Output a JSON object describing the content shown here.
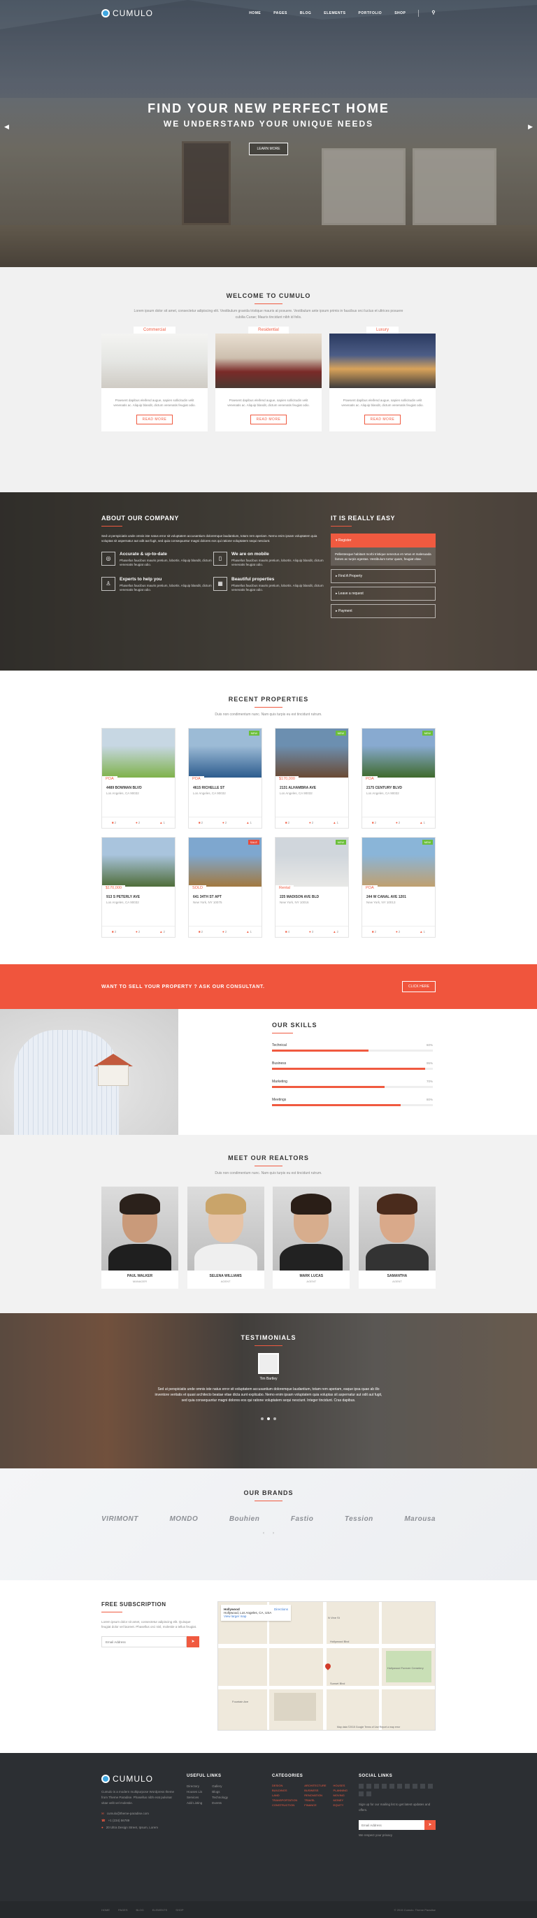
{
  "brand": {
    "name": "CUMULO",
    "accent": "#f05a40"
  },
  "nav": [
    "HOME",
    "PAGES",
    "BLOG",
    "ELEMENTS",
    "PORTFOLIO",
    "SHOP"
  ],
  "hero": {
    "title": "FIND YOUR NEW PERFECT HOME",
    "subtitle": "WE UNDERSTAND YOUR UNIQUE NEEDS",
    "button": "LEARN MORE"
  },
  "welcome": {
    "title": "WELCOME TO CUMULO",
    "text": "Lorem ipsum dolor sit amet, consectetur adipiscing elit. Vestibulum gravida tristique mauris at posuere. Vestibulum ante ipsum primis in faucibus orci luctus et ultrices posuere cubilia Curae; Mauris tincidunt nibh id felis.",
    "cards": [
      {
        "tag": "Commercial",
        "text": "Praesent dapibus eleifend augue, sapien sollicitudin velit venenatis ac. Aliquip blandit, dictum venenatis feugiat odio.",
        "button": "READ MORE"
      },
      {
        "tag": "Residential",
        "text": "Praesent dapibus eleifend augue, sapien sollicitudin velit venenatis ac. Aliquip blandit, dictum venenatis feugiat odio.",
        "button": "READ MORE"
      },
      {
        "tag": "Luxury",
        "text": "Praesent dapibus eleifend augue, sapien sollicitudin velit venenatis ac. Aliquip blandit, dictum venenatis feugiat odio.",
        "button": "READ MORE"
      }
    ]
  },
  "about": {
    "title": "ABOUT OUR COMPANY",
    "lead": "Sed ut perspiciatis unde omnis iste natus error sit voluptatem accusantium doloremque laudantium, totam rem aperiam. Nemo enim ipsam voluptatem quia voluptas sit aspernatur aut odit aut fugit, sed quia consequuntur magni dolores eos qui ratione voluptatem sequi nesciunt.",
    "features": [
      {
        "icon": "target-icon",
        "glyph": "◎",
        "title": "Accurate & up-to-date",
        "text": "Phasellus faucibus mauris pretium, lobortis. Aliquip blandit, dictum venenatis feugiat odio."
      },
      {
        "icon": "mobile-icon",
        "glyph": "▯",
        "title": "We are on mobile",
        "text": "Phasellus faucibus mauris pretium, lobortis. Aliquip blandit, dictum venenatis feugiat odio."
      },
      {
        "icon": "user-icon",
        "glyph": "♙",
        "title": "Experts to help you",
        "text": "Phasellus faucibus mauris pretium, lobortis. Aliquip blandit, dictum venenatis feugiat odio."
      },
      {
        "icon": "building-icon",
        "glyph": "▦",
        "title": "Beautiful properties",
        "text": "Phasellus faucibus mauris pretium, lobortis. Aliquip blandit, dictum venenatis feugiat odio."
      }
    ],
    "easy_title": "IT IS REALLY EASY",
    "steps": [
      {
        "label": "Register",
        "active": true,
        "body": "Pellentesque habitant morbi tristique senectus et netus et malesuada fames ac turpis egestas. Vestibulum tortor quam, feugiat vitae."
      },
      {
        "label": "Find A Property",
        "active": false
      },
      {
        "label": "Leave a request",
        "active": false
      },
      {
        "label": "Payment",
        "active": false
      }
    ]
  },
  "recent": {
    "title": "RECENT PROPERTIES",
    "subtitle": "Duis non condimentum nunc. Nam quis turpis eu est tincidunt rutrum.",
    "items": [
      {
        "addr": "4489 BOWMAN BLVD",
        "city": "Los Angeles, CA 90032",
        "price": "POA",
        "badge": "",
        "beds": "2",
        "baths": "2",
        "cars": "1",
        "c1": "#7fb24a",
        "c2": "#c7d7e3"
      },
      {
        "addr": "4615 RICHELLE ST",
        "city": "Los Angeles, CA 90032",
        "price": "POA",
        "badge": "NEW",
        "badgeColor": "#6bbf3a",
        "beds": "2",
        "baths": "2",
        "cars": "1",
        "c1": "#2d5c8e",
        "c2": "#9cbbd6"
      },
      {
        "addr": "2131 ALHAMBRA AVE",
        "city": "Los Angeles, CA 90032",
        "price": "$170,000",
        "badge": "NEW",
        "badgeColor": "#6bbf3a",
        "beds": "2",
        "baths": "2",
        "cars": "1",
        "c1": "#6a4a34",
        "c2": "#6c8fb0"
      },
      {
        "addr": "2175 CENTURY BLVD",
        "city": "Los Angeles, CA 90032",
        "price": "POA",
        "badge": "NEW",
        "badgeColor": "#6bbf3a",
        "beds": "2",
        "baths": "2",
        "cars": "1",
        "c1": "#3f6a2c",
        "c2": "#88aad0"
      },
      {
        "addr": "913 S PETERLY AVE",
        "city": "Los Angeles, CA 90032",
        "price": "$170,000",
        "badge": "",
        "beds": "3",
        "baths": "2",
        "cars": "2",
        "c1": "#4f6d39",
        "c2": "#a9c4dd"
      },
      {
        "addr": "641 34TH ST APT",
        "city": "New York, NY 10075",
        "price": "SOLD",
        "badge": "SALE",
        "badgeColor": "#e74c3c",
        "beds": "2",
        "baths": "2",
        "cars": "1",
        "c1": "#a2793f",
        "c2": "#7ea7cf"
      },
      {
        "addr": "225 MADISON AVE BLD",
        "city": "New York, NY 10016",
        "price": "Rental",
        "badge": "NEW",
        "badgeColor": "#6bbf3a",
        "beds": "4",
        "baths": "3",
        "cars": "2",
        "c1": "#e8e8e6",
        "c2": "#d0d6dc"
      },
      {
        "addr": "244 W CANAL AVE 1201",
        "city": "New York, NY 10013",
        "price": "POA",
        "badge": "NEW",
        "badgeColor": "#6bbf3a",
        "beds": "2",
        "baths": "2",
        "cars": "1",
        "c1": "#c0a06f",
        "c2": "#8ab5d8"
      }
    ]
  },
  "cta": {
    "text": "WANT TO SELL YOUR PROPERTY ? ASK OUR CONSULTANT.",
    "button": "CLICK HERE"
  },
  "skills": {
    "title": "OUR SKILLS",
    "items": [
      {
        "label": "Technical",
        "pct": 60
      },
      {
        "label": "Business",
        "pct": 95
      },
      {
        "label": "Marketing",
        "pct": 70
      },
      {
        "label": "Meetings",
        "pct": 80
      }
    ]
  },
  "realtors": {
    "title": "MEET OUR REALTORS",
    "subtitle": "Duis non condimentum nunc. Nam quis turpis eu est tincidunt rutrum.",
    "people": [
      {
        "name": "PAUL WALKER",
        "role": "MANAGER",
        "skin": "#c99a7a",
        "hair": "#2b211b",
        "shirt": "#1f1f1f"
      },
      {
        "name": "SELENA WILLIAMS",
        "role": "AGENT",
        "skin": "#e6c3a6",
        "hair": "#c9a46a",
        "shirt": "#efefef"
      },
      {
        "name": "MARK LUCAS",
        "role": "AGENT",
        "skin": "#d7ad8d",
        "hair": "#2a1e17",
        "shirt": "#222"
      },
      {
        "name": "SAMANTHA",
        "role": "AGENT",
        "skin": "#d9a98a",
        "hair": "#4a2b1c",
        "shirt": "#333"
      }
    ]
  },
  "testimonials": {
    "title": "TESTIMONIALS",
    "name": "Tim Bartley",
    "quote": "Sed ut perspiciatis unde omnis iste natus error sit voluptatem accusantium doloremque laudantium, totam rem aperiam, eaque ipsa quae ab illo inventore veritatis et quasi architecto beatae vitae dicta sunt explicabo. Nemo enim ipsam voluptatem quia voluptas sit aspernatur aut odit aut fugit, sed quia consequuntur magni dolores eos qui ratione voluptatem sequi nesciunt. Integer tincidunt. Cras dapibus."
  },
  "brands": {
    "title": "OUR BRANDS",
    "items": [
      "VIRIMONT",
      "MONDO",
      "Bouhien",
      "Fastio",
      "Tession",
      "Marousa"
    ]
  },
  "subscribe": {
    "title": "FREE SUBSCRIPTION",
    "text": "Lorem ipsum dolor sit amet, consectetur adipiscing elit. Quisque feugiat dolor vel laoreet. Phasellus orci nisl, molestie a tellus feugiat.",
    "placeholder": "Email Address"
  },
  "map": {
    "place": "Hollywood",
    "address": "Hollywood, Los Angeles, CA, USA",
    "link": "View larger map",
    "directions": "Directions",
    "labels": [
      "Hollywood Blvd",
      "Sunset Blvd",
      "N Vine St",
      "Fountain Ave",
      "Hollywood Forever Cemetery"
    ],
    "footer": "Map data ©2015 Google  Terms of Use  Report a map error"
  },
  "footer": {
    "about": "Cumulo is a modern multipurpose Wordpress theme from Theme Paradise. Phasellus nibh erat pulvinar vitae velit vel molestie.",
    "email": "cumulo@theme-paradise.com",
    "phone": "+1 (234) 56789",
    "address": "20 Ultra Design Street, Ipsum, Lorem",
    "useful_title": "USEFUL LINKS",
    "useful_a": [
      "Directory",
      "Houses Lis",
      "Services",
      "Add Listing"
    ],
    "useful_b": [
      "Gallery",
      "Blogs",
      "Technology",
      "Events"
    ],
    "cats_title": "CATEGORIES",
    "cats": [
      "DESIGN",
      "ARCHITECTURE",
      "HOUSES",
      "BUILDINGS",
      "BUSINESS",
      "PLANNING",
      "LAND",
      "RENOVATION",
      "MOVING",
      "TRANSPORTATION",
      "TRAVEL",
      "MONEY",
      "CONSTRUCTION",
      "FINANCE",
      "EQUITY"
    ],
    "social_title": "SOCIAL LINKS",
    "social_text": "Sign up for our mailing list to get latest updates and offers.",
    "placeholder": "Email Address",
    "note": "We respect your privacy",
    "bottom_links": [
      "HOME",
      "PAGES",
      "BLOG",
      "ELEMENTS",
      "SHOP"
    ],
    "copyright": "© 2015 Cumulo. Theme Paradise"
  }
}
